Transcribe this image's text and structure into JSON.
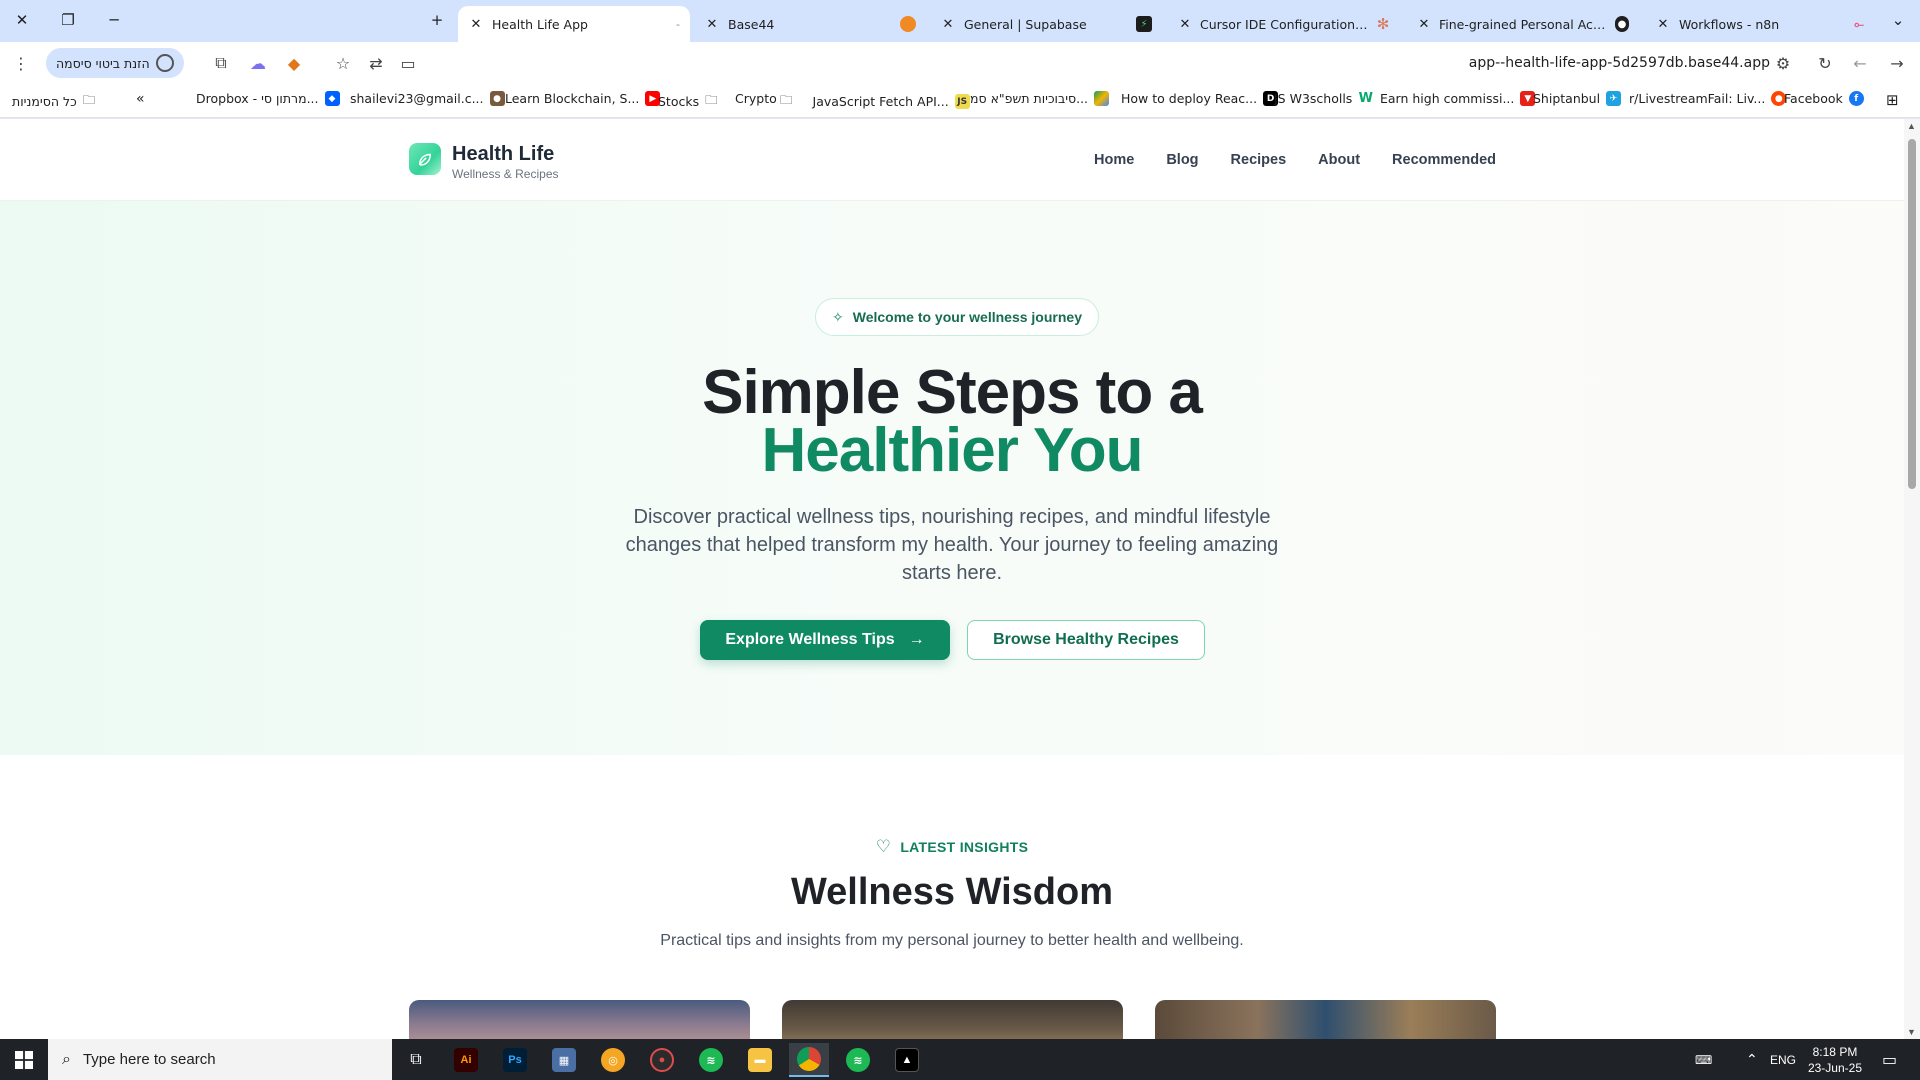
{
  "browser": {
    "tabs": [
      {
        "title": "Health Life App",
        "active": true
      },
      {
        "title": "Base44",
        "active": false
      },
      {
        "title": "General | Supabase",
        "active": false
      },
      {
        "title": "Cursor IDE Configuration Guide",
        "active": false
      },
      {
        "title": "Fine-grained Personal Access To",
        "active": false
      },
      {
        "title": "Workflows - n8n",
        "active": false
      }
    ],
    "password_chip": "הזנת ביטוי סיסמה",
    "url": "app--health-life-app-5d2597db.base44.app",
    "bookmarks": {
      "all_bookmarks": "כל הסימניות",
      "items": [
        "Dropbox - מרתון סי...",
        "shailevi23@gmail.c...",
        "Learn Blockchain, S...",
        "Stocks",
        "Crypto",
        "JavaScript Fetch API...",
        "סיבוכיות תשפ\"א סמ...",
        "How to deploy Reac...",
        "JS W3scholls",
        "Earn high commissi...",
        "Shiptanbul",
        "r/LivestreamFail: Liv...",
        "Facebook"
      ]
    }
  },
  "site": {
    "brand": {
      "name": "Health Life",
      "tagline": "Wellness & Recipes"
    },
    "nav": [
      "Home",
      "Blog",
      "Recipes",
      "About",
      "Recommended"
    ],
    "hero": {
      "pill": "Welcome to your wellness journey",
      "title_line1": "Simple Steps to a",
      "title_line2": "Healthier You",
      "description": "Discover practical wellness tips, nourishing recipes, and mindful lifestyle changes that helped transform my health. Your journey to feeling amazing starts here.",
      "primary_button": "Explore Wellness Tips",
      "secondary_button": "Browse Healthy Recipes"
    },
    "insights": {
      "tag": "LATEST INSIGHTS",
      "heading": "Wellness Wisdom",
      "subheading": "Practical tips and insights from my personal journey to better health and wellbeing."
    }
  },
  "taskbar": {
    "search_placeholder": "Type here to search",
    "language": "ENG",
    "time": "8:18 PM",
    "date": "23-Jun-25"
  },
  "colors": {
    "brand_green": "#0f8a63",
    "tabstrip": "#d3e3fd",
    "taskbar": "#1f2328"
  }
}
